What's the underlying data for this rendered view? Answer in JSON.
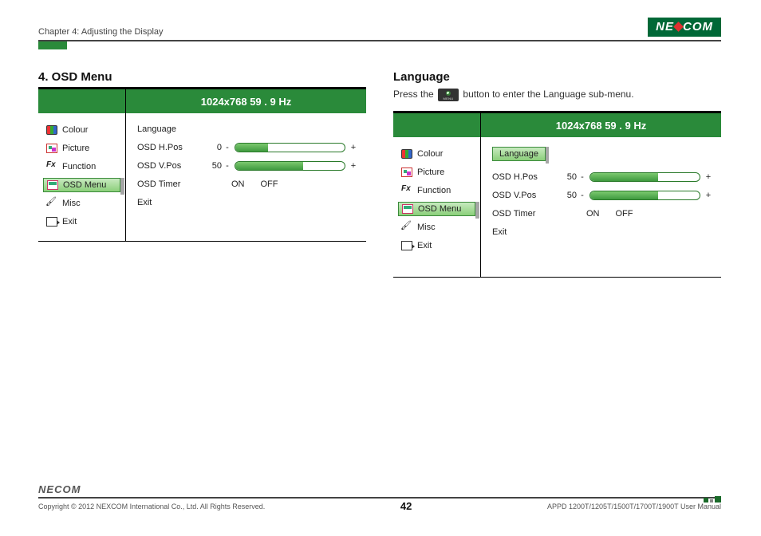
{
  "header": {
    "chapter": "Chapter 4: Adjusting the Display",
    "brand_left": "NE",
    "brand_right": "COM"
  },
  "left_panel": {
    "title": "4. OSD Menu",
    "banner": "1024x768  59  . 9 Hz",
    "sidebar": [
      {
        "label": "Colour",
        "icon": "colour"
      },
      {
        "label": "Picture",
        "icon": "picture"
      },
      {
        "label": "Function",
        "icon": "fn"
      },
      {
        "label": "OSD Menu",
        "icon": "osd",
        "selected": true
      },
      {
        "label": "Misc",
        "icon": "misc"
      },
      {
        "label": "Exit",
        "icon": "exit"
      }
    ],
    "rows": {
      "language": "Language",
      "hpos_label": "OSD H.Pos",
      "hpos_value": "0",
      "hpos_fill": 30,
      "vpos_label": "OSD V.Pos",
      "vpos_value": "50",
      "vpos_fill": 62,
      "timer_label": "OSD Timer",
      "on": "ON",
      "off": "OFF",
      "exit": "Exit"
    }
  },
  "right_panel": {
    "title": "Language",
    "intro_pre": "Press the",
    "intro_post": "button to enter the Language sub-menu.",
    "banner": "1024x768  59  . 9 Hz",
    "sidebar": [
      {
        "label": "Colour",
        "icon": "colour"
      },
      {
        "label": "Picture",
        "icon": "picture"
      },
      {
        "label": "Function",
        "icon": "fn"
      },
      {
        "label": "OSD Menu",
        "icon": "osd",
        "selected": true
      },
      {
        "label": "Misc",
        "icon": "misc"
      },
      {
        "label": "Exit",
        "icon": "exit"
      }
    ],
    "rows": {
      "language": "Language",
      "hpos_label": "OSD H.Pos",
      "hpos_value": "50",
      "hpos_fill": 62,
      "vpos_label": "OSD V.Pos",
      "vpos_value": "50",
      "vpos_fill": 62,
      "timer_label": "OSD Timer",
      "on": "ON",
      "off": "OFF",
      "exit": "Exit"
    }
  },
  "footer": {
    "copyright": "Copyright © 2012 NEXCOM International Co., Ltd. All Rights Reserved.",
    "page": "42",
    "doc": "APPD 1200T/1205T/1500T/1700T/1900T User Manual"
  }
}
